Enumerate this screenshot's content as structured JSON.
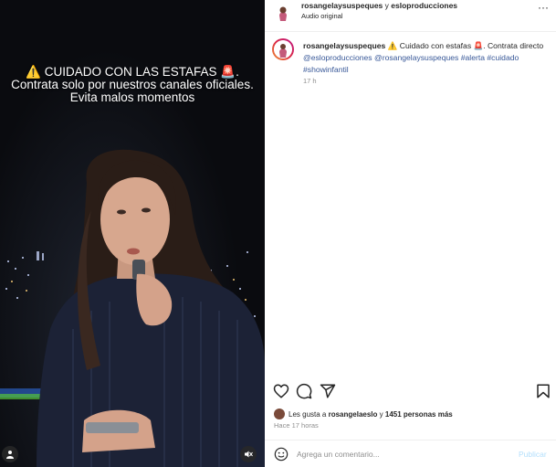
{
  "video": {
    "overlay": {
      "line1_warn_icon": "⚠️",
      "line1_text": "CUIDADO CON LAS ESTAFAS",
      "line1_siren": "🚨",
      "line1_end": ".",
      "line2": "Contrata solo por nuestros canales oficiales.",
      "line3": "Evita malos momentos"
    },
    "icons": {
      "user": "user-icon",
      "mute": "muted-speaker-icon"
    }
  },
  "header": {
    "user1": "rosangelaysuspeques",
    "and": "y",
    "user2": "esloproducciones",
    "audio": "Audio original",
    "more": "···"
  },
  "caption": {
    "username": "rosangelaysuspeques",
    "text_a": "⚠️ Cuidado con estafas 🚨. Contrata directo",
    "mention1": "@esloproducciones",
    "mention2": "@rosangelaysuspeques",
    "tag1": "#alerta",
    "tag2": "#cuidado",
    "tag3": "#showinfantil",
    "time": "17 h"
  },
  "likes": {
    "prefix": "Les gusta a",
    "user": "rosangelaeslo",
    "middle": "y",
    "others": "1451 personas más"
  },
  "ago": "Hace 17 horas",
  "comment": {
    "placeholder": "Agrega un comentario...",
    "publish": "Publicar"
  },
  "colors": {
    "link": "#385898",
    "publish_disabled": "#b2dffc",
    "muted_text": "#8e8e8e"
  }
}
